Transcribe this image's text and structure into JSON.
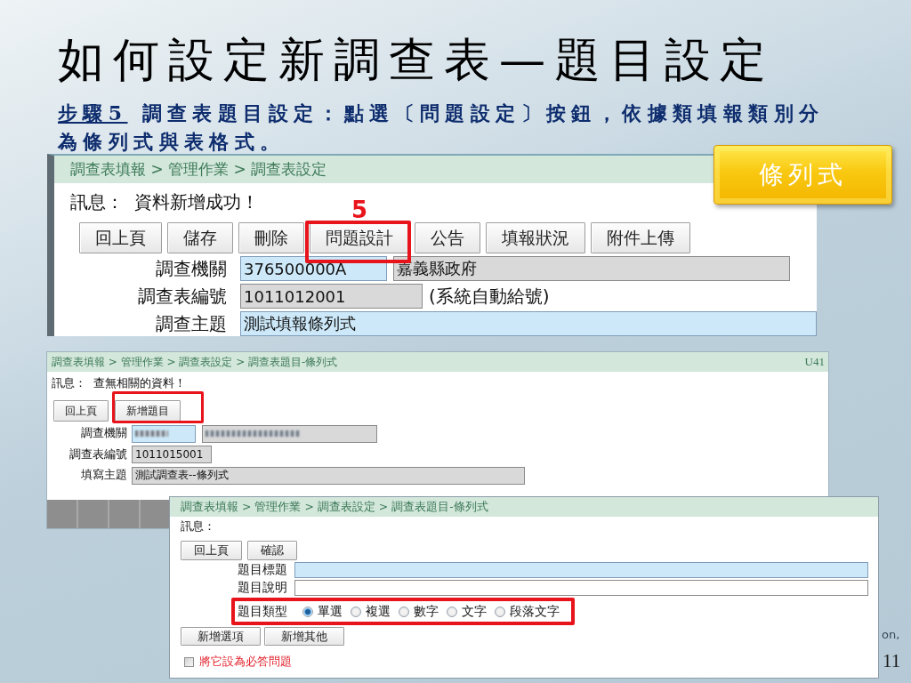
{
  "slide": {
    "title": "如何設定新調查表—題目設定",
    "step_label": "步驟5",
    "step_text": "調查表題目設定：點選〔問題設定〕按鈕，依據類填報類別分為條列式與表格式。",
    "callout": "條列式",
    "footer_text": "on,",
    "page_number": "11"
  },
  "screens": [
    {
      "breadcrumb": "調查表填報 > 管理作業 > 調查表設定",
      "message_label": "訊息：",
      "message": "資料新增成功！",
      "buttons": [
        {
          "label": "回上頁",
          "highlighted": false
        },
        {
          "label": "儲存",
          "highlighted": false
        },
        {
          "label": "刪除",
          "highlighted": false
        },
        {
          "label": "問題設計",
          "highlighted": true,
          "marker": "5"
        },
        {
          "label": "公告",
          "highlighted": false
        },
        {
          "label": "填報狀況",
          "highlighted": false
        },
        {
          "label": "附件上傳",
          "highlighted": false
        }
      ],
      "fields": [
        {
          "kind": "input",
          "label": "調查機關",
          "inputs": [
            {
              "kind": "tinted",
              "value": "376500000A"
            },
            {
              "kind": "readonly",
              "value": "嘉義縣政府"
            }
          ]
        },
        {
          "kind": "input",
          "label": "調查表編號",
          "inputs": [
            {
              "kind": "readonly",
              "value": "1011012001"
            }
          ],
          "note": "(系統自動給號)"
        },
        {
          "kind": "input",
          "label": "調查主題",
          "inputs": [
            {
              "kind": "tinted",
              "value": "測試填報條列式"
            }
          ]
        }
      ]
    },
    {
      "breadcrumb": "調查表填報 > 管理作業 > 調查表設定 > 調查表題目-條列式",
      "corner_code": "U41",
      "message_label": "訊息：",
      "message": "查無相關的資料！",
      "buttons": [
        {
          "label": "回上頁",
          "highlighted": false
        },
        {
          "label": "新增題目",
          "highlighted": true
        }
      ],
      "fields": [
        {
          "kind": "input",
          "label": "調查機關",
          "inputs": [
            {
              "kind": "tinted",
              "obscured": true
            },
            {
              "kind": "readonly",
              "obscured": true
            }
          ]
        },
        {
          "kind": "input",
          "label": "調查表編號",
          "inputs": [
            {
              "kind": "readonly",
              "value": "1011015001"
            }
          ]
        },
        {
          "kind": "input",
          "label": "填寫主題",
          "inputs": [
            {
              "kind": "readonly",
              "value": "測試調查表--條列式"
            }
          ]
        }
      ]
    },
    {
      "breadcrumb": "調查表填報 > 管理作業 > 調查表設定 > 調查表題目-條列式",
      "message_label": "訊息：",
      "buttons": [
        {
          "label": "回上頁",
          "highlighted": false
        },
        {
          "label": "確認",
          "highlighted": false
        }
      ],
      "fields": [
        {
          "kind": "input",
          "label": "題目標題",
          "highlighted": false,
          "inputs": [
            {
              "kind": "tinted"
            }
          ]
        },
        {
          "kind": "input",
          "label": "題目說明",
          "highlighted": false,
          "inputs": [
            {
              "kind": "plain"
            }
          ]
        },
        {
          "kind": "radio",
          "label": "題目類型",
          "highlighted": true,
          "options": [
            {
              "label": "單選",
              "selected": true
            },
            {
              "label": "複選",
              "selected": false
            },
            {
              "label": "數字",
              "selected": false
            },
            {
              "label": "文字",
              "selected": false
            },
            {
              "label": "段落文字",
              "selected": false
            }
          ]
        }
      ],
      "option_buttons": [
        {
          "label": "新增選項"
        },
        {
          "label": "新增其他"
        }
      ],
      "checkbox": {
        "label": "將它設為必答問題",
        "checked": false
      }
    }
  ]
}
